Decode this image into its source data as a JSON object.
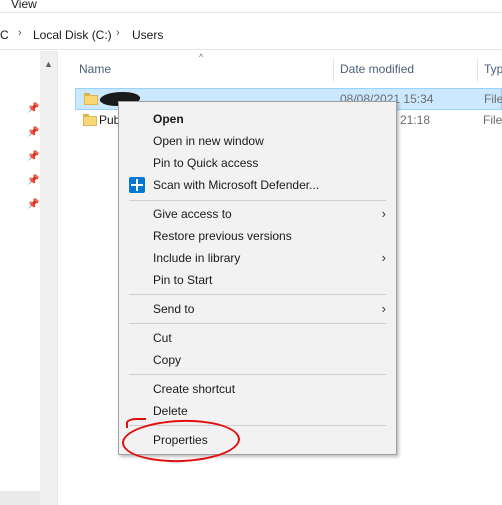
{
  "ribbon": {
    "tab_view": "View"
  },
  "breadcrumb": {
    "items": [
      "PC",
      "Local Disk (C:)",
      "Users"
    ],
    "separator": "›"
  },
  "columns": {
    "name": "Name",
    "date_modified": "Date modified",
    "type": "Typ"
  },
  "files": [
    {
      "name": "",
      "date": "08/08/2021 15:34",
      "type": "File",
      "selected": true,
      "name_redacted": true
    },
    {
      "name": "Pub",
      "date": "21:18",
      "type": "File",
      "selected": false
    }
  ],
  "context_menu": {
    "items": [
      {
        "label": "Open",
        "bold": true
      },
      {
        "label": "Open in new window"
      },
      {
        "label": "Pin to Quick access"
      },
      {
        "label": "Scan with Microsoft Defender...",
        "icon": "defender-icon"
      },
      {
        "label": "Give access to",
        "submenu": true
      },
      {
        "label": "Restore previous versions"
      },
      {
        "label": "Include in library",
        "submenu": true
      },
      {
        "label": "Pin to Start"
      },
      {
        "label": "Send to",
        "submenu": true
      },
      {
        "label": "Cut"
      },
      {
        "label": "Copy"
      },
      {
        "label": "Create shortcut"
      },
      {
        "label": "Delete"
      },
      {
        "label": "Properties",
        "highlighted_by_annotation": true
      }
    ]
  },
  "colors": {
    "selection_bg": "#cce8ff",
    "selection_border": "#99d1ff",
    "menu_bg": "#f2f2f2",
    "annotation": "#e01010",
    "folder": "#f8d775"
  }
}
